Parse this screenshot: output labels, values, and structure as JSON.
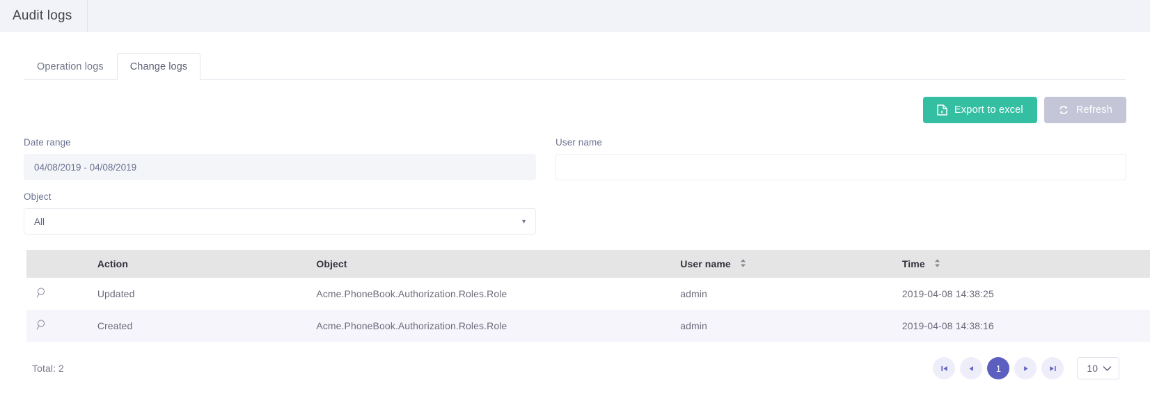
{
  "header": {
    "title": "Audit logs"
  },
  "tabs": [
    {
      "label": "Operation logs",
      "active": false,
      "name": "tab-operation-logs"
    },
    {
      "label": "Change logs",
      "active": true,
      "name": "tab-change-logs"
    }
  ],
  "toolbar": {
    "export_label": "Export to excel",
    "refresh_label": "Refresh",
    "export_color": "#34bfa3",
    "refresh_color": "#c4c5d6"
  },
  "filters": {
    "date_range": {
      "label": "Date range",
      "value": "04/08/2019 - 04/08/2019"
    },
    "user_name": {
      "label": "User name",
      "value": "",
      "placeholder": ""
    },
    "object": {
      "label": "Object",
      "value": "All"
    }
  },
  "table": {
    "columns": [
      {
        "label": "",
        "sortable": false,
        "key": "detail"
      },
      {
        "label": "Action",
        "sortable": false,
        "key": "action"
      },
      {
        "label": "Object",
        "sortable": false,
        "key": "object"
      },
      {
        "label": "User name",
        "sortable": true,
        "key": "user"
      },
      {
        "label": "Time",
        "sortable": true,
        "key": "time"
      }
    ],
    "rows": [
      {
        "action": "Updated",
        "object": "Acme.PhoneBook.Authorization.Roles.Role",
        "user": "admin",
        "time": "2019-04-08 14:38:25"
      },
      {
        "action": "Created",
        "object": "Acme.PhoneBook.Authorization.Roles.Role",
        "user": "admin",
        "time": "2019-04-08 14:38:16"
      }
    ]
  },
  "footer": {
    "total_label": "Total: 2",
    "pagination": {
      "first_label": "⏮",
      "prev_label": "◀",
      "next_label": "▶",
      "last_label": "⏭",
      "pages": [
        "1"
      ],
      "current_page": "1",
      "page_size": "10",
      "active_color": "#5d5fc0"
    }
  }
}
